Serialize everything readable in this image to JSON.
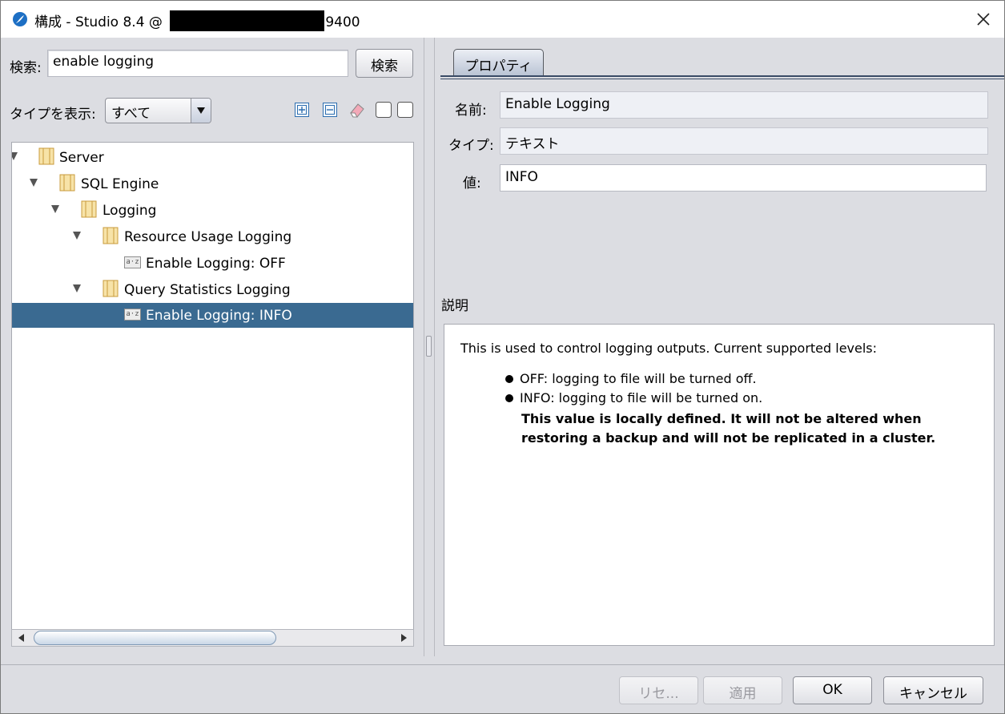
{
  "window": {
    "title_prefix": "構成 - Studio 8.4 @ ",
    "title_suffix": "9400",
    "close_icon": "close-icon"
  },
  "search": {
    "label": "検索:",
    "value": "enable logging",
    "button": "検索"
  },
  "type_filter": {
    "label": "タイプを表示:",
    "selected": "すべて"
  },
  "toolbar_icons": [
    "expand-all-icon",
    "collapse-all-icon",
    "eraser-icon",
    "checkbox-icon",
    "checkbox-icon"
  ],
  "tree": {
    "items": [
      {
        "label": "Server",
        "type": "folder",
        "depth": 0,
        "expanded": true
      },
      {
        "label": "SQL Engine",
        "type": "folder",
        "depth": 1,
        "expanded": true
      },
      {
        "label": "Logging",
        "type": "folder",
        "depth": 2,
        "expanded": true
      },
      {
        "label": "Resource Usage Logging",
        "type": "folder",
        "depth": 3,
        "expanded": true
      },
      {
        "label": "Enable Logging: OFF",
        "type": "leaf",
        "depth": 4
      },
      {
        "label": "Query Statistics Logging",
        "type": "folder",
        "depth": 3,
        "expanded": true
      },
      {
        "label": "Enable Logging: INFO",
        "type": "leaf",
        "depth": 4,
        "selected": true
      }
    ],
    "leaf_icon_text": "a·z"
  },
  "properties": {
    "tab": "プロパティ",
    "name_label": "名前:",
    "name_value": "Enable Logging",
    "type_label": "タイプ:",
    "type_value": "テキスト",
    "value_label": "値:",
    "value_value": "INFO",
    "description_label": "説明",
    "description": {
      "intro": "This is used to control logging outputs. Current supported levels:",
      "items": [
        "OFF: logging to file will be turned off.",
        "INFO: logging to file will be turned on."
      ],
      "note": "This value is locally defined. It will not be altered when restoring a backup and will not be replicated in a cluster."
    }
  },
  "footer": {
    "reset": "リセ...",
    "apply": "適用",
    "ok": "OK",
    "cancel": "キャンセル"
  },
  "colors": {
    "selection": "#3a6a91",
    "window_bg": "#dcdde2"
  }
}
